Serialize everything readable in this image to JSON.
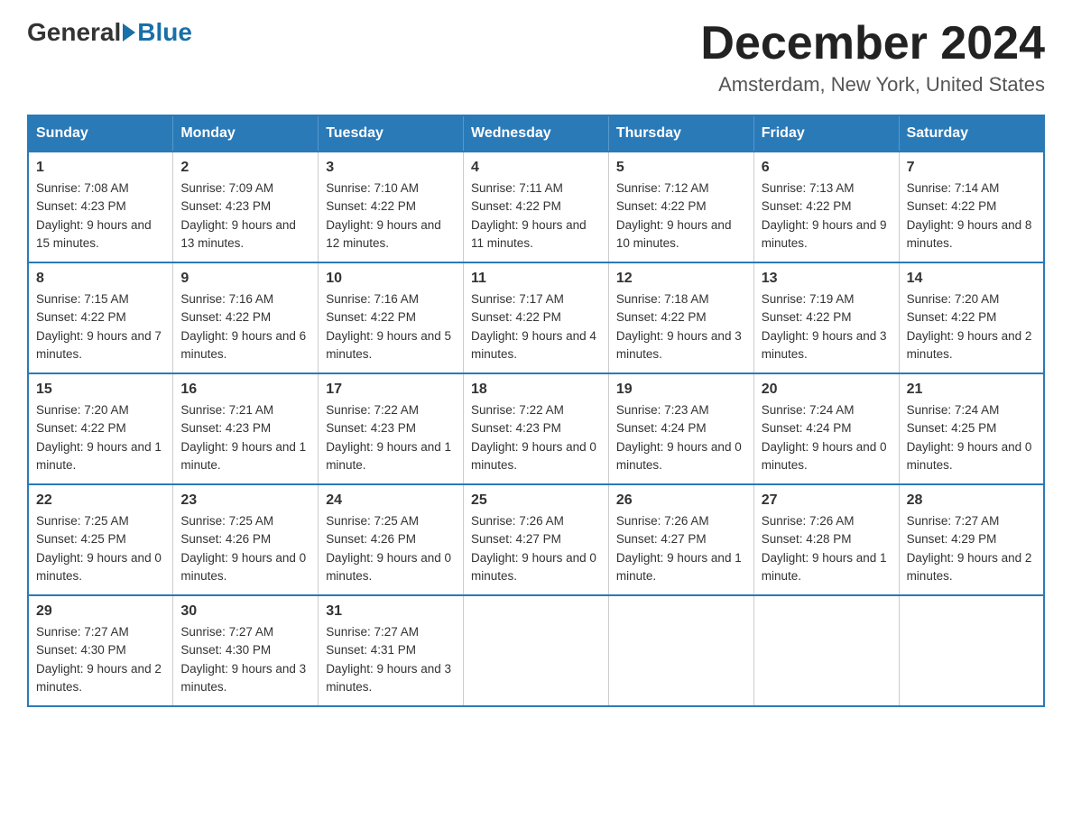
{
  "header": {
    "logo_general": "General",
    "logo_blue": "Blue",
    "month_title": "December 2024",
    "location": "Amsterdam, New York, United States"
  },
  "days_of_week": [
    "Sunday",
    "Monday",
    "Tuesday",
    "Wednesday",
    "Thursday",
    "Friday",
    "Saturday"
  ],
  "weeks": [
    [
      {
        "day": "1",
        "sunrise": "7:08 AM",
        "sunset": "4:23 PM",
        "daylight": "9 hours and 15 minutes."
      },
      {
        "day": "2",
        "sunrise": "7:09 AM",
        "sunset": "4:23 PM",
        "daylight": "9 hours and 13 minutes."
      },
      {
        "day": "3",
        "sunrise": "7:10 AM",
        "sunset": "4:22 PM",
        "daylight": "9 hours and 12 minutes."
      },
      {
        "day": "4",
        "sunrise": "7:11 AM",
        "sunset": "4:22 PM",
        "daylight": "9 hours and 11 minutes."
      },
      {
        "day": "5",
        "sunrise": "7:12 AM",
        "sunset": "4:22 PM",
        "daylight": "9 hours and 10 minutes."
      },
      {
        "day": "6",
        "sunrise": "7:13 AM",
        "sunset": "4:22 PM",
        "daylight": "9 hours and 9 minutes."
      },
      {
        "day": "7",
        "sunrise": "7:14 AM",
        "sunset": "4:22 PM",
        "daylight": "9 hours and 8 minutes."
      }
    ],
    [
      {
        "day": "8",
        "sunrise": "7:15 AM",
        "sunset": "4:22 PM",
        "daylight": "9 hours and 7 minutes."
      },
      {
        "day": "9",
        "sunrise": "7:16 AM",
        "sunset": "4:22 PM",
        "daylight": "9 hours and 6 minutes."
      },
      {
        "day": "10",
        "sunrise": "7:16 AM",
        "sunset": "4:22 PM",
        "daylight": "9 hours and 5 minutes."
      },
      {
        "day": "11",
        "sunrise": "7:17 AM",
        "sunset": "4:22 PM",
        "daylight": "9 hours and 4 minutes."
      },
      {
        "day": "12",
        "sunrise": "7:18 AM",
        "sunset": "4:22 PM",
        "daylight": "9 hours and 3 minutes."
      },
      {
        "day": "13",
        "sunrise": "7:19 AM",
        "sunset": "4:22 PM",
        "daylight": "9 hours and 3 minutes."
      },
      {
        "day": "14",
        "sunrise": "7:20 AM",
        "sunset": "4:22 PM",
        "daylight": "9 hours and 2 minutes."
      }
    ],
    [
      {
        "day": "15",
        "sunrise": "7:20 AM",
        "sunset": "4:22 PM",
        "daylight": "9 hours and 1 minute."
      },
      {
        "day": "16",
        "sunrise": "7:21 AM",
        "sunset": "4:23 PM",
        "daylight": "9 hours and 1 minute."
      },
      {
        "day": "17",
        "sunrise": "7:22 AM",
        "sunset": "4:23 PM",
        "daylight": "9 hours and 1 minute."
      },
      {
        "day": "18",
        "sunrise": "7:22 AM",
        "sunset": "4:23 PM",
        "daylight": "9 hours and 0 minutes."
      },
      {
        "day": "19",
        "sunrise": "7:23 AM",
        "sunset": "4:24 PM",
        "daylight": "9 hours and 0 minutes."
      },
      {
        "day": "20",
        "sunrise": "7:24 AM",
        "sunset": "4:24 PM",
        "daylight": "9 hours and 0 minutes."
      },
      {
        "day": "21",
        "sunrise": "7:24 AM",
        "sunset": "4:25 PM",
        "daylight": "9 hours and 0 minutes."
      }
    ],
    [
      {
        "day": "22",
        "sunrise": "7:25 AM",
        "sunset": "4:25 PM",
        "daylight": "9 hours and 0 minutes."
      },
      {
        "day": "23",
        "sunrise": "7:25 AM",
        "sunset": "4:26 PM",
        "daylight": "9 hours and 0 minutes."
      },
      {
        "day": "24",
        "sunrise": "7:25 AM",
        "sunset": "4:26 PM",
        "daylight": "9 hours and 0 minutes."
      },
      {
        "day": "25",
        "sunrise": "7:26 AM",
        "sunset": "4:27 PM",
        "daylight": "9 hours and 0 minutes."
      },
      {
        "day": "26",
        "sunrise": "7:26 AM",
        "sunset": "4:27 PM",
        "daylight": "9 hours and 1 minute."
      },
      {
        "day": "27",
        "sunrise": "7:26 AM",
        "sunset": "4:28 PM",
        "daylight": "9 hours and 1 minute."
      },
      {
        "day": "28",
        "sunrise": "7:27 AM",
        "sunset": "4:29 PM",
        "daylight": "9 hours and 2 minutes."
      }
    ],
    [
      {
        "day": "29",
        "sunrise": "7:27 AM",
        "sunset": "4:30 PM",
        "daylight": "9 hours and 2 minutes."
      },
      {
        "day": "30",
        "sunrise": "7:27 AM",
        "sunset": "4:30 PM",
        "daylight": "9 hours and 3 minutes."
      },
      {
        "day": "31",
        "sunrise": "7:27 AM",
        "sunset": "4:31 PM",
        "daylight": "9 hours and 3 minutes."
      },
      null,
      null,
      null,
      null
    ]
  ],
  "labels": {
    "sunrise_prefix": "Sunrise: ",
    "sunset_prefix": "Sunset: ",
    "daylight_prefix": "Daylight: "
  }
}
